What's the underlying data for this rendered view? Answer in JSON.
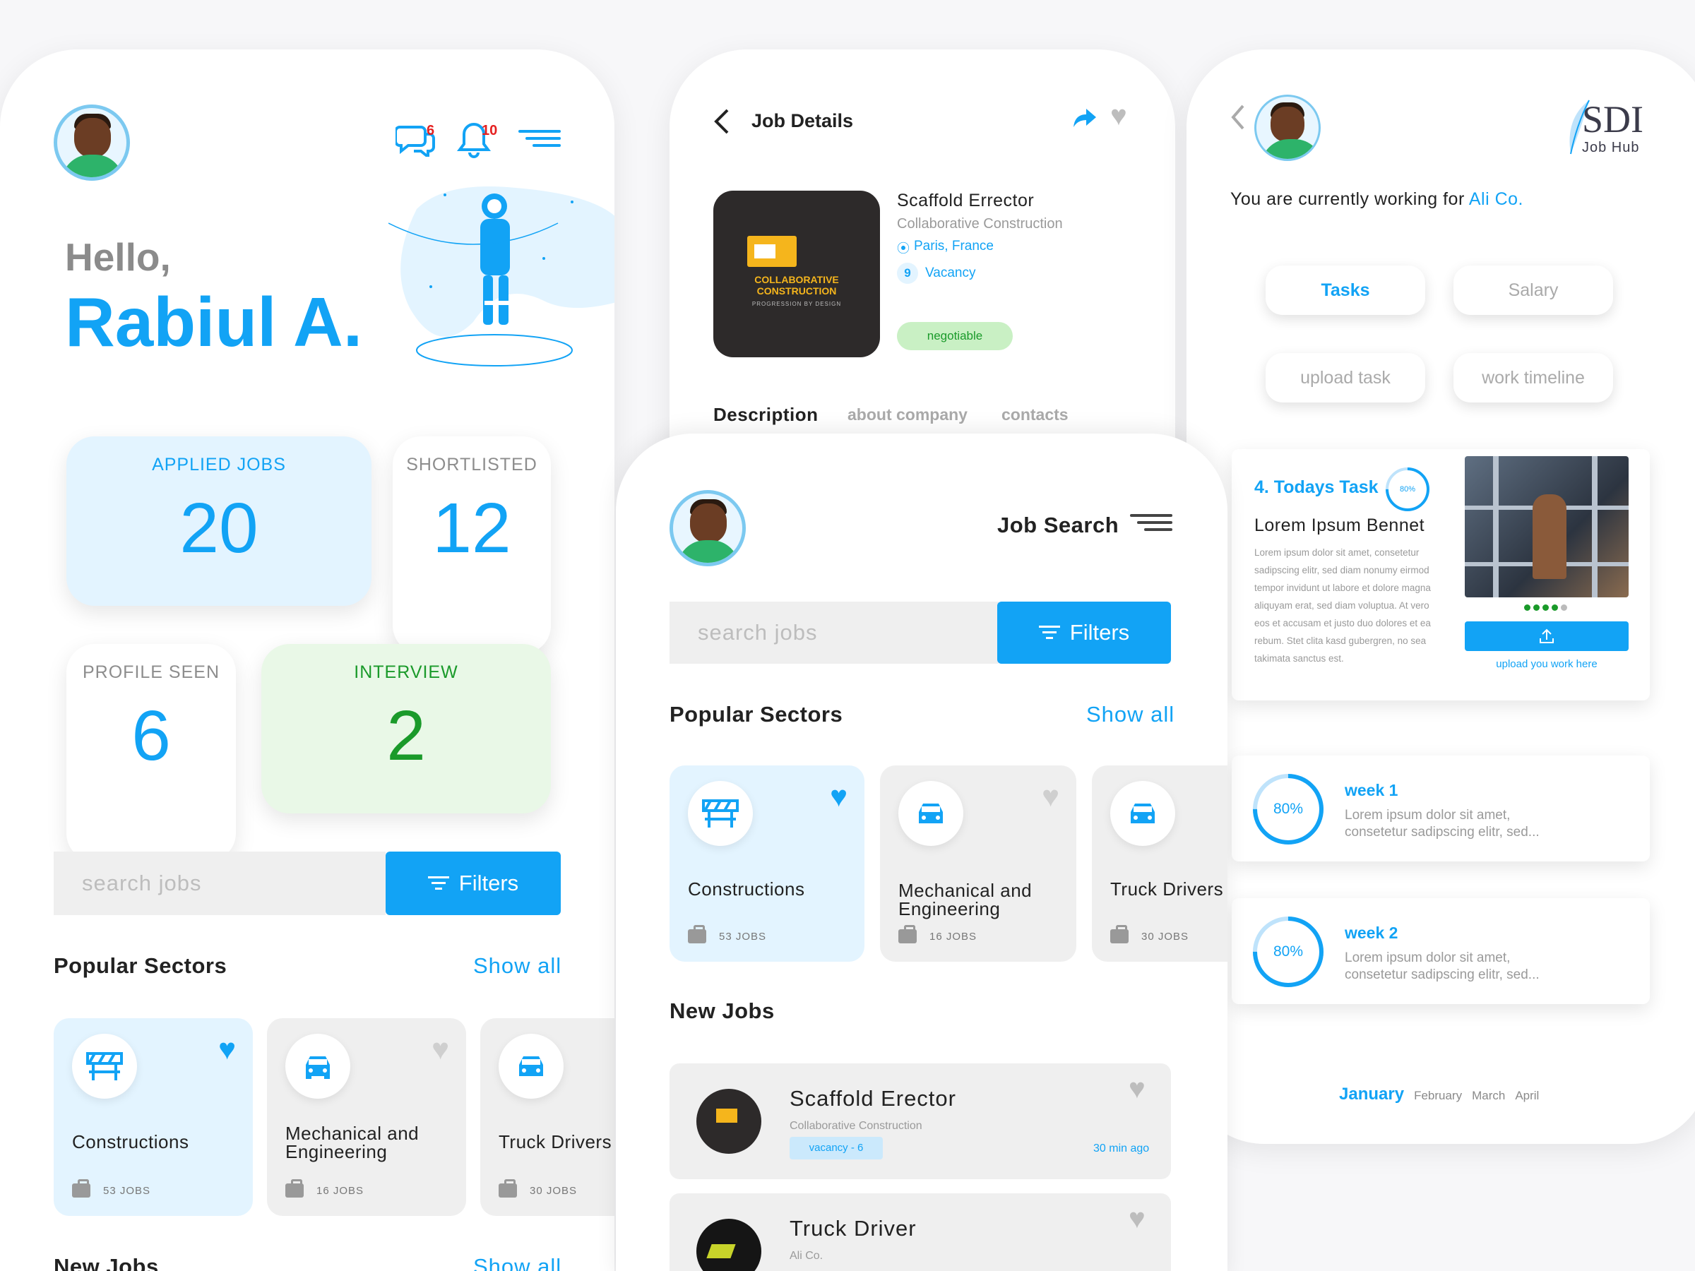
{
  "colors": {
    "accent": "#12a3f5",
    "light_blue": "#e3f4ff",
    "light_green": "#e9f8e7",
    "green": "#1a9a2a",
    "dark": "#2d2a2a"
  },
  "screen1": {
    "greeting": "Hello,",
    "name": "Rabiul A.",
    "messages_badge": "6",
    "notifications_badge": "10",
    "stats": {
      "applied": {
        "label": "APPLIED JOBS",
        "value": "20"
      },
      "shortlisted": {
        "label": "SHORTLISTED",
        "value": "12"
      },
      "profile": {
        "label": "PROFILE SEEN",
        "value": "6"
      },
      "interview": {
        "label": "INTERVIEW",
        "value": "2"
      }
    },
    "search_placeholder": "search jobs",
    "filters_label": "Filters",
    "popular_sectors": "Popular Sectors",
    "show_all": "Show all",
    "sectors": [
      {
        "name": "Constructions",
        "jobs": "53 JOBS",
        "icon": "barrier-icon"
      },
      {
        "name": "Mechanical and Engineering",
        "jobs": "16 JOBS",
        "icon": "car-icon"
      },
      {
        "name": "Truck Drivers",
        "jobs": "30 JOBS",
        "icon": "car-icon"
      }
    ],
    "new_jobs": "New Jobs",
    "show_all_2": "Show all"
  },
  "screen2": {
    "title": "Job Details",
    "job_title": "Scaffold Errector",
    "company": "Collaborative Construction",
    "location": "Paris, France",
    "vacancy_count": "9",
    "vacancy_label": "Vacancy",
    "salary_tag": "negotiable",
    "logo_line1": "COLLABORATIVE",
    "logo_line2": "CONSTRUCTION",
    "logo_tagline": "PROGRESSION BY DESIGN",
    "tabs": [
      "Description",
      "about company",
      "contacts"
    ]
  },
  "screen3": {
    "title": "Job Search",
    "search_placeholder": "search jobs",
    "filters_label": "Filters",
    "popular_sectors": "Popular Sectors",
    "show_all": "Show all",
    "sectors": [
      {
        "name": "Constructions",
        "jobs": "53 JOBS"
      },
      {
        "name": "Mechanical and Engineering",
        "jobs": "16 JOBS"
      },
      {
        "name": "Truck Drivers",
        "jobs": "30 JOBS"
      }
    ],
    "new_jobs": "New Jobs",
    "jobs": [
      {
        "title": "Scaffold Erector",
        "company": "Collaborative Construction",
        "vacancy": "vacancy - 6",
        "time": "30 min ago"
      },
      {
        "title": "Truck Driver",
        "company": "Ali Co."
      }
    ]
  },
  "screen4": {
    "brand": "SDI",
    "brand_sub": "Job Hub",
    "working_prefix": "You are currently working for ",
    "working_company": "Ali Co.",
    "chips": [
      "Tasks",
      "Salary",
      "upload task",
      "work timeline"
    ],
    "task": {
      "title": "4. Todays Task",
      "progress": "80%",
      "name": "Lorem Ipsum Bennet",
      "body": "Lorem ipsum dolor sit amet, consetetur sadipscing elitr, sed diam nonumy eirmod tempor invidunt ut labore et dolore magna aliquyam erat, sed diam voluptua. At vero eos et accusam et justo duo dolores et ea rebum. Stet clita kasd gubergren, no sea takimata sanctus est.",
      "upload_label": "upload you work here"
    },
    "weeks": [
      {
        "title": "week 1",
        "pct": "80%",
        "line1": "Lorem ipsum dolor sit amet,",
        "line2": "consetetur sadipscing elitr, sed..."
      },
      {
        "title": "week 2",
        "pct": "80%",
        "line1": "Lorem ipsum dolor sit amet,",
        "line2": "consetetur sadipscing elitr, sed..."
      }
    ],
    "months": [
      "January",
      "February",
      "March",
      "April"
    ]
  }
}
